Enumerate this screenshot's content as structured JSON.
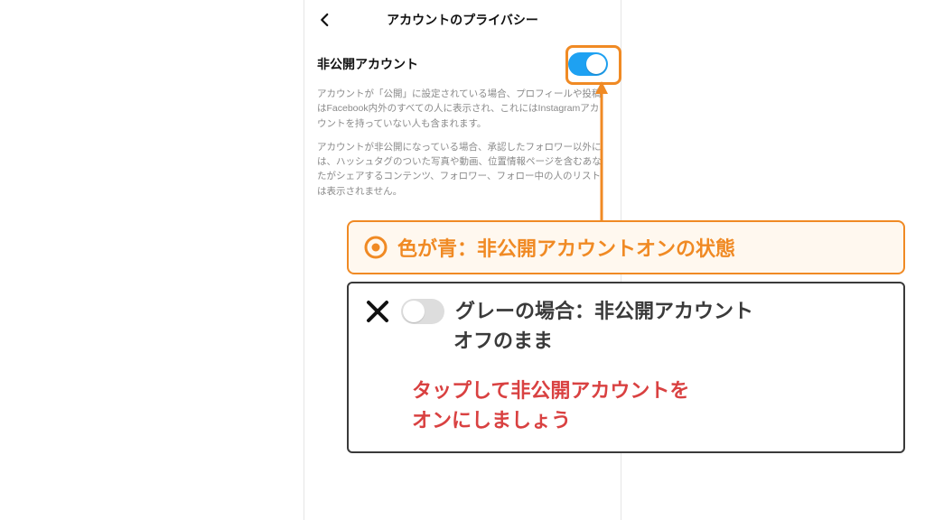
{
  "header": {
    "title": "アカウントのプライバシー"
  },
  "setting": {
    "label": "非公開アカウント",
    "desc1": "アカウントが「公開」に設定されている場合、プロフィールや投稿はFacebook内外のすべての人に表示され、これにはInstagramアカウントを持っていない人も含まれます。",
    "desc2": "アカウントが非公開になっている場合、承認したフォロワー以外には、ハッシュタグのついた写真や動画、位置情報ページを含むあなたがシェアするコンテンツ、フォロワー、フォロー中の人のリストは表示されません。"
  },
  "callout_on": {
    "text": "色が青：非公開アカウントオンの状態"
  },
  "callout_off": {
    "line1": "グレーの場合：非公開アカウント",
    "line2": "オフのまま",
    "action1": "タップして非公開アカウントを",
    "action2": "オンにしましょう"
  },
  "colors": {
    "orange": "#f08a24",
    "blue": "#1ea1f2",
    "red": "#d94141"
  }
}
